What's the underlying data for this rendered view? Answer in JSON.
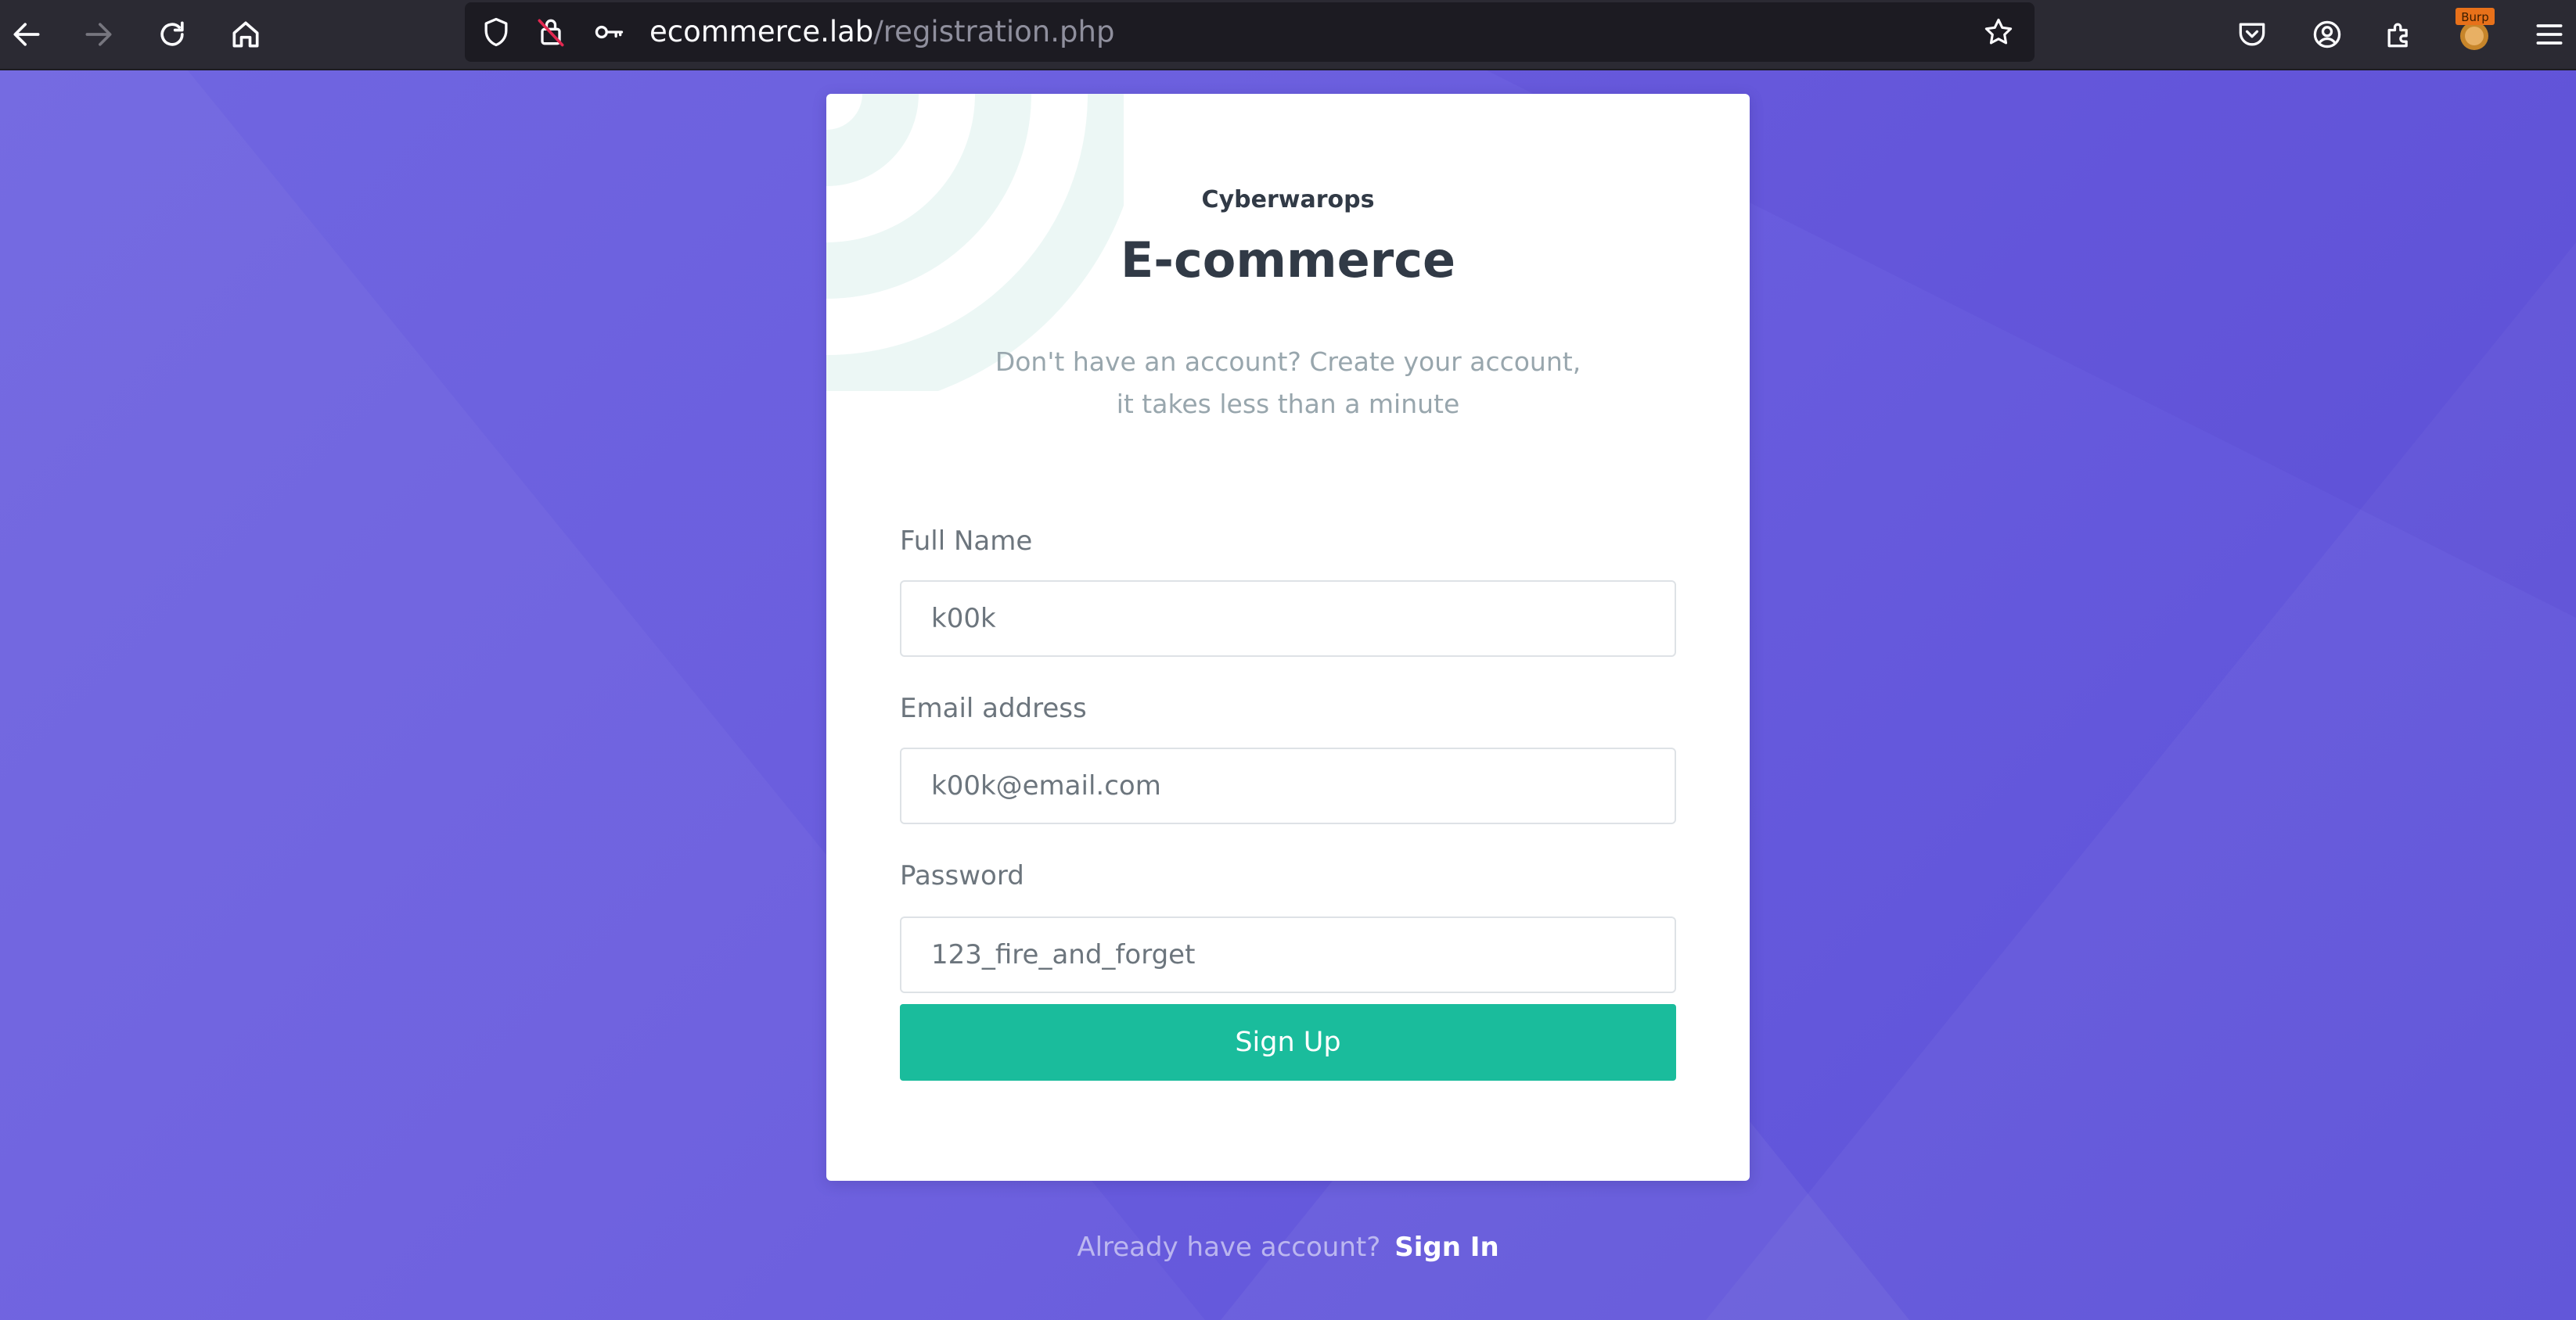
{
  "browser": {
    "url_host": "ecommerce.lab",
    "url_path": "/registration.php",
    "burp_badge": "Burp",
    "icons": {
      "back": "arrow-left-icon",
      "forward": "arrow-right-icon",
      "reload": "reload-icon",
      "home": "home-icon",
      "tracking_protection": "shield-icon",
      "insecure_connection": "lock-insecure-icon",
      "permissions": "key-icon",
      "bookmark": "star-icon",
      "pocket": "pocket-icon",
      "account": "account-icon",
      "extensions": "puzzle-icon",
      "burp": "burp-icon",
      "menu": "hamburger-menu-icon"
    }
  },
  "brand": {
    "small": "Cyberwarops",
    "title": "E-commerce"
  },
  "subtitle": {
    "line1": "Don't have an account? Create your account,",
    "line2": "it takes less than a minute"
  },
  "form": {
    "fullname": {
      "label": "Full Name",
      "value": "k00k"
    },
    "email": {
      "label": "Email address",
      "value": "k00k@email.com"
    },
    "password": {
      "label": "Password",
      "value": "123_fire_and_forget"
    },
    "submit": "Sign Up"
  },
  "footer": {
    "prompt": "Already have account?",
    "link": "Sign In"
  },
  "colors": {
    "background": "#6a5ddd",
    "accent": "#1abc9c",
    "card": "#ffffff",
    "heading": "#313a46",
    "muted": "#98a6ad"
  }
}
